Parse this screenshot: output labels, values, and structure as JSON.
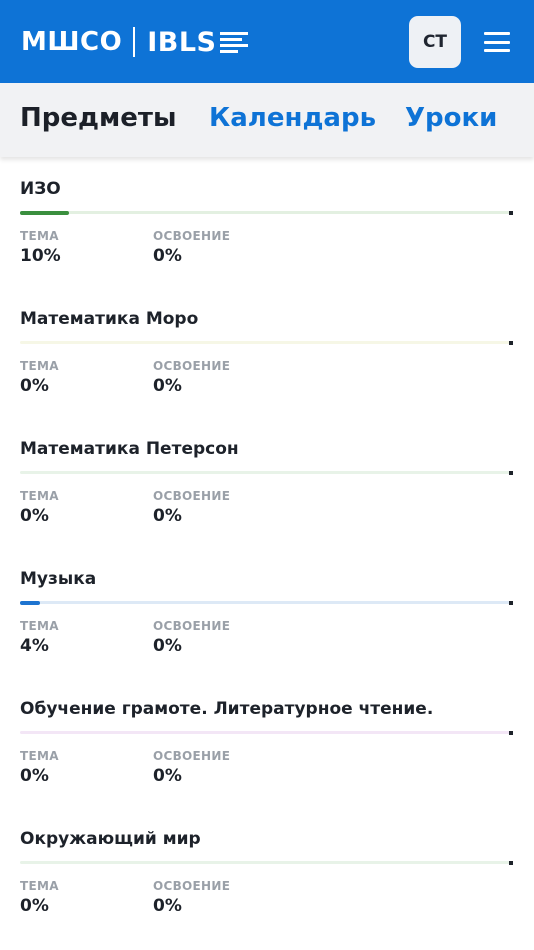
{
  "header": {
    "logo_left": "МШСО",
    "logo_right": "IBLS",
    "avatar_initials": "СТ",
    "brand_color": "#0e73d6"
  },
  "tabs": [
    {
      "label": "Предметы",
      "active": true
    },
    {
      "label": "Календарь",
      "active": false
    },
    {
      "label": "Уроки",
      "active": false
    }
  ],
  "labels": {
    "topic": "ТЕМА",
    "mastery": "ОСВОЕНИЕ"
  },
  "subjects": [
    {
      "title": "ИЗО",
      "topic": "10%",
      "mastery": "0%",
      "progress": 0.1,
      "color": "#3a8f3e",
      "track": "#e3f0e1"
    },
    {
      "title": "Математика Моро",
      "topic": "0%",
      "mastery": "0%",
      "progress": 0.0,
      "color": "#c9d27a",
      "track": "#f6f7e6"
    },
    {
      "title": "Математика Петерсон",
      "topic": "0%",
      "mastery": "0%",
      "progress": 0.0,
      "color": "#8cc28f",
      "track": "#e8f3e8"
    },
    {
      "title": "Музыка",
      "topic": "4%",
      "mastery": "0%",
      "progress": 0.04,
      "color": "#1d74d0",
      "track": "#dde9f6"
    },
    {
      "title": "Обучение грамоте. Литературное чтение.",
      "topic": "0%",
      "mastery": "0%",
      "progress": 0.0,
      "color": "#c78ad6",
      "track": "#f3e6f6"
    },
    {
      "title": "Окружающий мир",
      "topic": "0%",
      "mastery": "0%",
      "progress": 0.0,
      "color": "#8cc28f",
      "track": "#e8f3e8"
    }
  ]
}
